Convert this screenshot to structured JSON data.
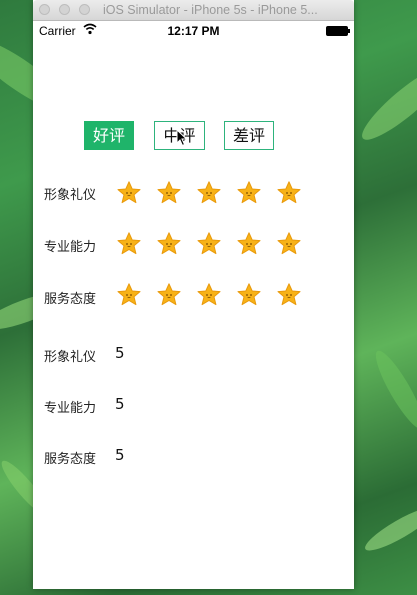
{
  "window": {
    "title": "iOS Simulator - iPhone 5s - iPhone 5..."
  },
  "status_bar": {
    "carrier": "Carrier",
    "time": "12:17 PM"
  },
  "segments": [
    {
      "label": "好评",
      "selected": true
    },
    {
      "label": "中评",
      "selected": false
    },
    {
      "label": "差评",
      "selected": false
    }
  ],
  "rating_rows": [
    {
      "label": "形象礼仪",
      "stars": 5
    },
    {
      "label": "专业能力",
      "stars": 5
    },
    {
      "label": "服务态度",
      "stars": 5
    }
  ],
  "score_rows": [
    {
      "label": "形象礼仪",
      "value": "5"
    },
    {
      "label": "专业能力",
      "value": "5"
    },
    {
      "label": "服务态度",
      "value": "5"
    }
  ],
  "colors": {
    "accent": "#1fb46a",
    "star": "#f7b217"
  },
  "icons": {
    "star": "star-icon",
    "wifi": "wifi-icon",
    "battery": "battery-icon",
    "cursor": "mouse-cursor-icon"
  }
}
